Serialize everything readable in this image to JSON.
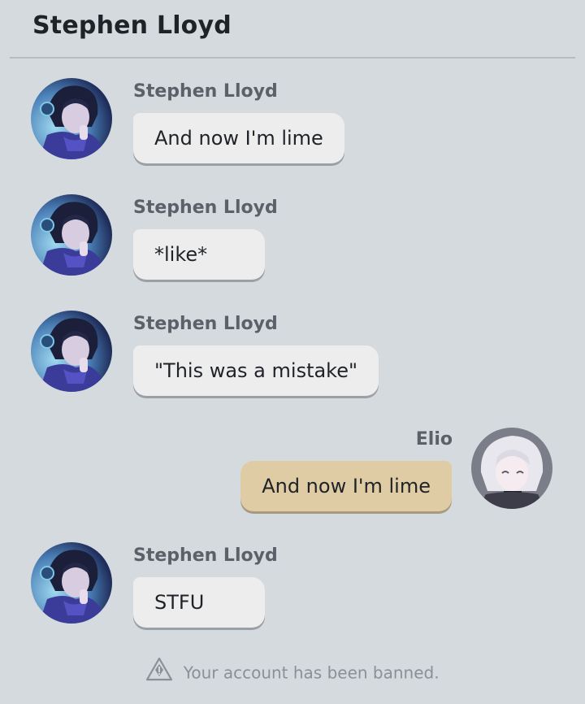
{
  "header": {
    "title": "Stephen Lloyd"
  },
  "messages": [
    {
      "sender": "Stephen Lloyd",
      "text": "And now I'm lime"
    },
    {
      "sender": "Stephen Lloyd",
      "text": "*like*"
    },
    {
      "sender": "Stephen Lloyd",
      "text": "\"This was a mistake\""
    },
    {
      "sender": "Elio",
      "text": "And now I'm lime"
    },
    {
      "sender": "Stephen Lloyd",
      "text": "STFU"
    }
  ],
  "footer": {
    "notice": "Your account has been banned.",
    "icon": "warning-icon"
  },
  "colors": {
    "background": "#d5dadf",
    "incoming_bubble": "#ededee",
    "outgoing_bubble": "#dfcba4"
  }
}
